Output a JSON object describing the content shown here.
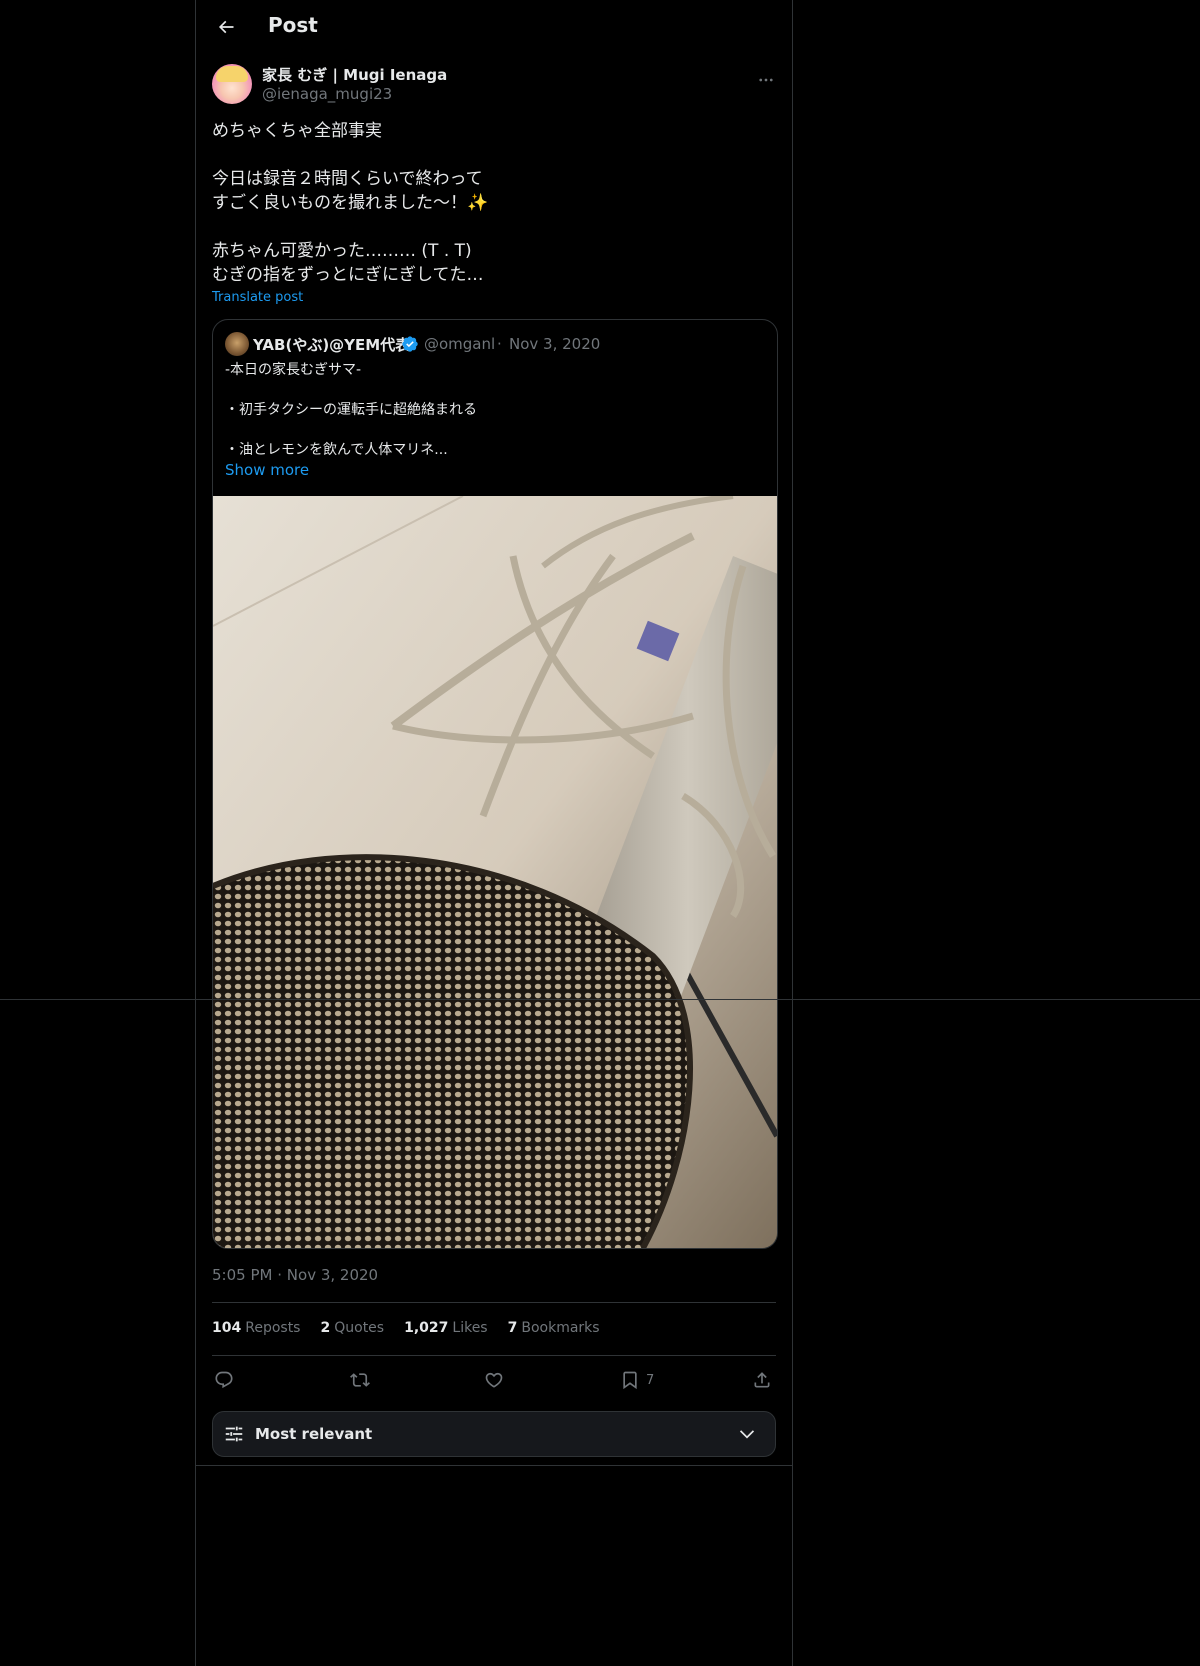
{
  "header": {
    "title": "Post",
    "back_icon": "arrow-left-icon"
  },
  "post": {
    "author_name": "家長 むぎ | Mugi Ienaga",
    "author_handle": "@ienaga_mugi23",
    "text_lines": [
      "めちゃくちゃ全部事実",
      "",
      "今日は録音２時間くらいで終わって",
      "すごく良いものを撮れました〜！✨",
      "",
      "赤ちゃん可愛かった……… (T . T)",
      "むぎの指をずっとにぎにぎしてた…"
    ],
    "translate_label": "Translate post",
    "timestamp_time": "5:05 PM",
    "timestamp_sep": "·",
    "timestamp_date": "Nov 3, 2020"
  },
  "quote": {
    "name": "YAB(やぶ)@YEM代表",
    "handle": "@omganl",
    "separator": "·",
    "date": "Nov 3, 2020",
    "verified": true,
    "text_lines": [
      "-本日の家長むぎサマ-",
      "",
      "・初手タクシーの運転手に超絶絡まれる",
      "",
      "・油とレモンを飲んで人体マリネ..."
    ],
    "show_more_label": "Show more",
    "image_subject": "condenser microphone in shock mount with pop filter"
  },
  "stats": {
    "reposts_count": "104",
    "reposts_label": "Reposts",
    "quotes_count": "2",
    "quotes_label": "Quotes",
    "likes_count": "1,027",
    "likes_label": "Likes",
    "bookmarks_count": "7",
    "bookmarks_label": "Bookmarks"
  },
  "actions": {
    "reply_icon": "reply-icon",
    "repost_icon": "repost-icon",
    "like_icon": "heart-icon",
    "bookmark_icon": "bookmark-icon",
    "bookmark_count": "7",
    "share_icon": "share-icon"
  },
  "sort": {
    "label": "Most relevant",
    "icon": "sliders-icon",
    "chevron": "chevron-down-icon"
  },
  "colors": {
    "background": "#000000",
    "text": "#e7e9ea",
    "muted": "#71767b",
    "accent": "#1d9bf0",
    "border": "#2f3336"
  }
}
